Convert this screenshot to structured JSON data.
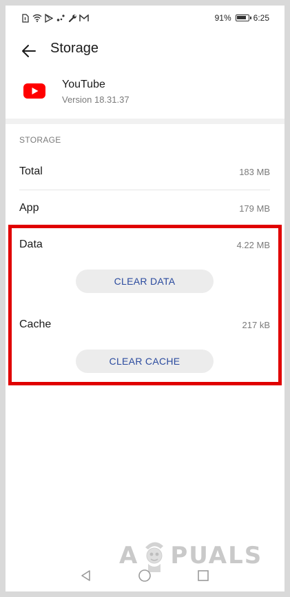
{
  "status_bar": {
    "icons": [
      "sim-icon",
      "wifi-icon",
      "play-store-icon",
      "cast-icon",
      "wrench-icon",
      "gmail-icon"
    ],
    "battery_percent": "91%",
    "battery_level": 0.91,
    "time": "6:25"
  },
  "header": {
    "title": "Storage",
    "back_icon": "arrow-left-icon"
  },
  "app": {
    "name": "YouTube",
    "version": "Version 18.31.37",
    "icon": "youtube-icon"
  },
  "storage": {
    "section_title": "STORAGE",
    "rows": [
      {
        "label": "Total",
        "value": "183 MB"
      },
      {
        "label": "App",
        "value": "179 MB"
      },
      {
        "label": "Data",
        "value": "4.22 MB"
      },
      {
        "label": "Cache",
        "value": "217 kB"
      }
    ],
    "clear_data_label": "CLEAR DATA",
    "clear_cache_label": "CLEAR CACHE"
  },
  "watermark": {
    "left": "A",
    "right": "PUALS"
  },
  "nav_bar": {
    "back_icon": "triangle-back-icon",
    "home_icon": "circle-home-icon",
    "recents_icon": "square-recents-icon"
  },
  "colors": {
    "accent": "#2a4a9e",
    "highlight": "#e00000",
    "youtube_red": "#ff0000"
  }
}
